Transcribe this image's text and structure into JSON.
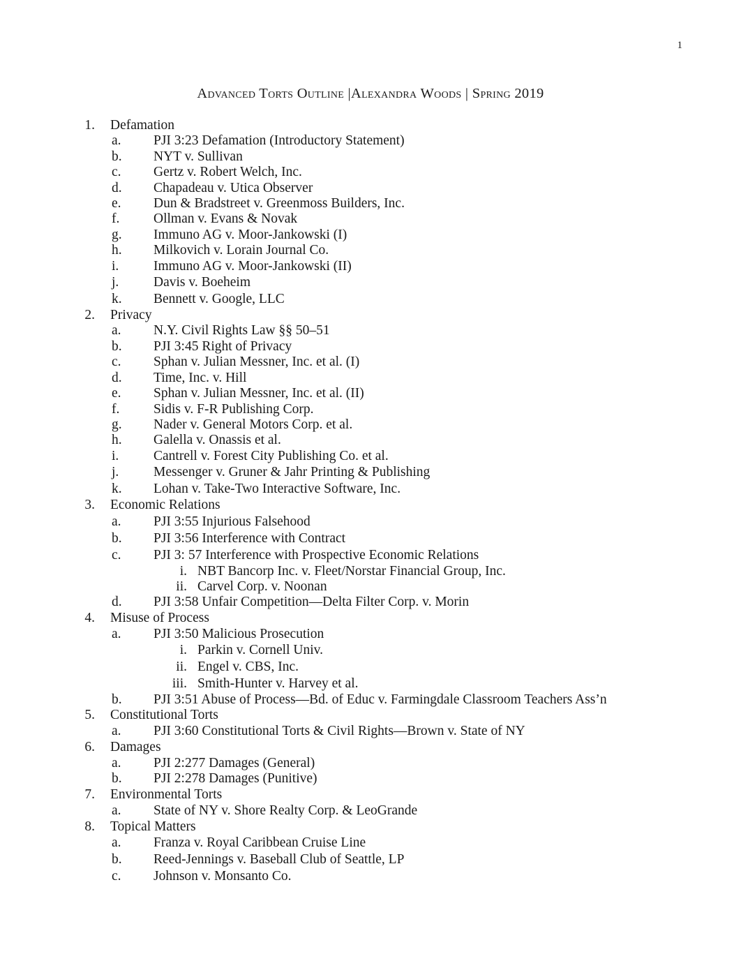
{
  "page": {
    "number": "1",
    "title": "Advanced Torts Outline |Alexandra Woods | Spring 2019"
  },
  "outline": [
    {
      "marker": "1.",
      "label": "Defamation",
      "children": [
        {
          "marker": "a.",
          "label": "PJI 3:23 Defamation (Introductory Statement)"
        },
        {
          "marker": "b.",
          "label": "NYT v. Sullivan"
        },
        {
          "marker": "c.",
          "label": "Gertz v. Robert Welch, Inc."
        },
        {
          "marker": "d.",
          "label": "Chapadeau v. Utica Observer"
        },
        {
          "marker": "e.",
          "label": "Dun & Bradstreet v. Greenmoss Builders, Inc."
        },
        {
          "marker": "f.",
          "label": "Ollman v. Evans & Novak"
        },
        {
          "marker": "g.",
          "label": "Immuno AG v. Moor-Jankowski (I)"
        },
        {
          "marker": "h.",
          "label": "Milkovich v. Lorain Journal Co."
        },
        {
          "marker": "i.",
          "label": "Immuno AG v. Moor-Jankowski (II)"
        },
        {
          "marker": "j.",
          "label": "Davis v. Boeheim"
        },
        {
          "marker": "k.",
          "label": "Bennett v. Google, LLC"
        }
      ]
    },
    {
      "marker": "2.",
      "label": "Privacy",
      "children": [
        {
          "marker": "a.",
          "label": "N.Y. Civil Rights Law §§ 50–51"
        },
        {
          "marker": "b.",
          "label": "PJI 3:45 Right of Privacy"
        },
        {
          "marker": "c.",
          "label": "Sphan v. Julian Messner, Inc. et al. (I)"
        },
        {
          "marker": "d.",
          "label": "Time, Inc. v. Hill"
        },
        {
          "marker": "e.",
          "label": "Sphan v. Julian Messner, Inc. et al. (II)"
        },
        {
          "marker": "f.",
          "label": "Sidis v. F-R Publishing Corp."
        },
        {
          "marker": "g.",
          "label": "Nader v. General Motors Corp. et al."
        },
        {
          "marker": "h.",
          "label": "Galella v. Onassis et al."
        },
        {
          "marker": "i.",
          "label": "Cantrell v. Forest City Publishing Co. et al."
        },
        {
          "marker": "j.",
          "label": "Messenger v. Gruner & Jahr Printing & Publishing"
        },
        {
          "marker": "k.",
          "label": "Lohan v. Take-Two Interactive Software, Inc."
        }
      ]
    },
    {
      "marker": "3.",
      "label": "Economic Relations",
      "children": [
        {
          "marker": "a.",
          "label": "PJI 3:55 Injurious Falsehood"
        },
        {
          "marker": "b.",
          "label": "PJI 3:56 Interference with Contract"
        },
        {
          "marker": "c.",
          "label": "PJI 3: 57 Interference with Prospective Economic Relations",
          "children": [
            {
              "marker": "i.",
              "label": "NBT Bancorp Inc. v. Fleet/Norstar Financial Group, Inc."
            },
            {
              "marker": "ii.",
              "label": "Carvel Corp. v. Noonan"
            }
          ]
        },
        {
          "marker": "d.",
          "label": "PJI 3:58 Unfair Competition—Delta Filter Corp. v. Morin"
        }
      ]
    },
    {
      "marker": "4.",
      "label": "Misuse of Process",
      "children": [
        {
          "marker": "a.",
          "label": "PJI 3:50 Malicious Prosecution",
          "children": [
            {
              "marker": "i.",
              "label": "Parkin v. Cornell Univ."
            },
            {
              "marker": "ii.",
              "label": "Engel v. CBS, Inc."
            },
            {
              "marker": "iii.",
              "label": "Smith-Hunter v. Harvey et al."
            }
          ]
        },
        {
          "marker": "b.",
          "label": "PJI 3:51 Abuse of Process—Bd. of Educ v. Farmingdale Classroom Teachers Ass’n"
        }
      ]
    },
    {
      "marker": "5.",
      "label": "Constitutional Torts",
      "children": [
        {
          "marker": "a.",
          "label": "PJI 3:60 Constitutional Torts & Civil Rights—Brown v. State of NY"
        }
      ]
    },
    {
      "marker": "6.",
      "label": "Damages",
      "children": [
        {
          "marker": "a.",
          "label": "PJI 2:277 Damages (General)"
        },
        {
          "marker": "b.",
          "label": "PJI 2:278 Damages (Punitive)"
        }
      ]
    },
    {
      "marker": "7.",
      "label": "Environmental Torts",
      "children": [
        {
          "marker": "a.",
          "label": "State of NY v. Shore Realty Corp. & LeoGrande"
        }
      ]
    },
    {
      "marker": "8.",
      "label": "Topical Matters",
      "children": [
        {
          "marker": "a.",
          "label": "Franza v. Royal Caribbean Cruise Line"
        },
        {
          "marker": "b.",
          "label": "Reed-Jennings v. Baseball Club of Seattle, LP"
        },
        {
          "marker": "c.",
          "label": "Johnson v. Monsanto Co."
        }
      ]
    }
  ]
}
